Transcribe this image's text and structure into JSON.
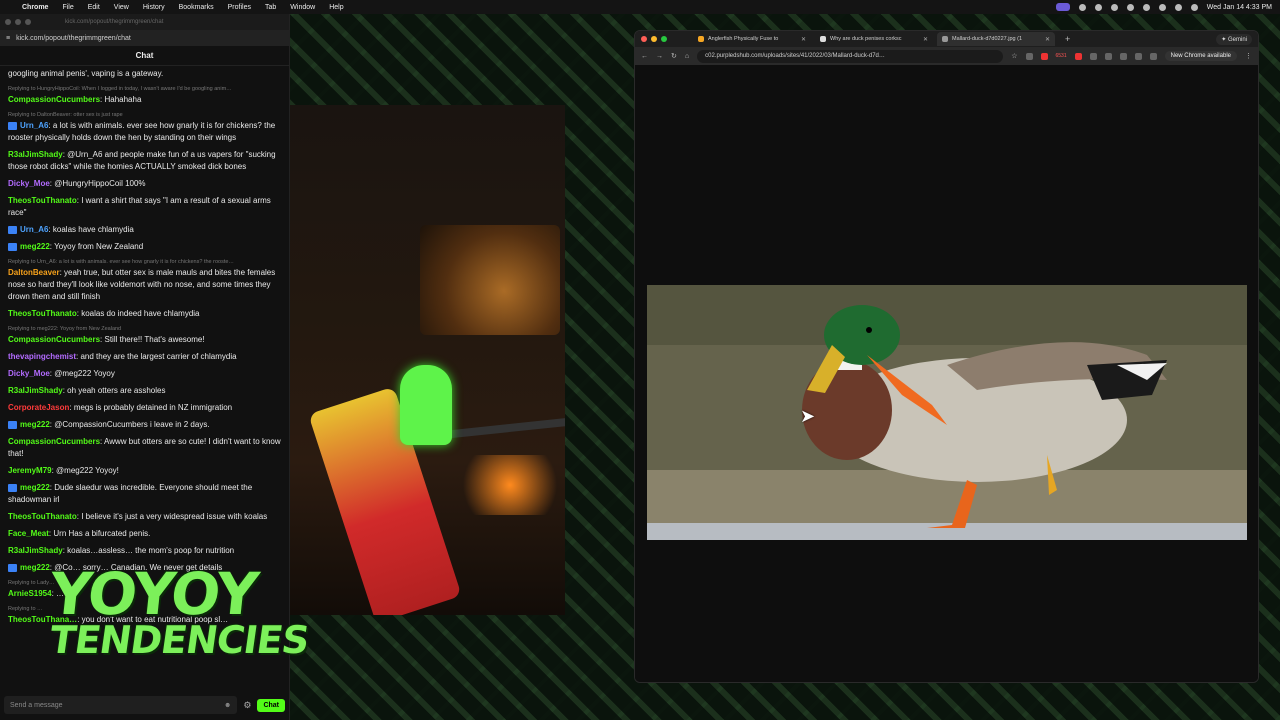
{
  "menubar": {
    "app": "Chrome",
    "items": [
      "File",
      "Edit",
      "View",
      "History",
      "Bookmarks",
      "Profiles",
      "Tab",
      "Window",
      "Help"
    ],
    "clock": "Wed Jan 14  4:33 PM"
  },
  "chat": {
    "top_faint": "kick.com/popout/thegrimmgreen/chat",
    "url": "kick.com/popout/thegrimmgreen/chat",
    "header": "Chat",
    "input_placeholder": "Send a message",
    "send_label": "Chat",
    "messages": [
      {
        "user": "",
        "color": "#eaeaea",
        "text": "googling animal penis', vaping is a gateway.",
        "reply": "",
        "badge": false
      },
      {
        "user": "CompassionCucumbers",
        "color": "#53fc18",
        "text": "Hahahaha",
        "reply": "Replying to HungryHippoCoil: When I logged in today, I wasn't aware I'd be googling anim…",
        "badge": false
      },
      {
        "user": "Urn_A6",
        "color": "#4ea3ff",
        "text": "a lot is with animals. ever see how gnarly it is for chickens? the rooster physically holds down the hen by standing on their wings",
        "reply": "Replying to DaltonBeaver: otter sex is just rape",
        "badge": true
      },
      {
        "user": "R3alJimShady",
        "color": "#53fc18",
        "text": "@Urn_A6 and people make fun of a us vapers for \"sucking those robot dicks\" while the homies ACTUALLY smoked dick bones",
        "reply": "",
        "badge": false
      },
      {
        "user": "Dicky_Moe",
        "color": "#b36bff",
        "text": "@HungryHippoCoil 100%",
        "reply": "",
        "badge": false
      },
      {
        "user": "TheosTouThanato",
        "color": "#53fc18",
        "text": "I want a shirt that says \"I am a result of a sexual arms race\"",
        "reply": "",
        "badge": false
      },
      {
        "user": "Urn_A6",
        "color": "#4ea3ff",
        "text": "koalas have chlamydia",
        "reply": "",
        "badge": true
      },
      {
        "user": "meg222",
        "color": "#53fc18",
        "text": "Yoyoy from New Zealand",
        "reply": "",
        "badge": true
      },
      {
        "user": "DaltonBeaver",
        "color": "#f7a21b",
        "text": "yeah true, but otter sex is male mauls and bites the females nose so hard they'll look like voldemort with no nose, and some times they drown them and still finish",
        "reply": "Replying to Urn_A6: a lot is with animals. ever see how gnarly it is for chickens? the rooste…",
        "badge": false
      },
      {
        "user": "TheosTouThanato",
        "color": "#53fc18",
        "text": "koalas do indeed have chlamydia",
        "reply": "",
        "badge": false
      },
      {
        "user": "CompassionCucumbers",
        "color": "#53fc18",
        "text": "Still there!! That's awesome!",
        "reply": "Replying to meg222: Yoyoy from New Zealand",
        "badge": false
      },
      {
        "user": "thevapingchemist",
        "color": "#b36bff",
        "text": "and they are the largest carrier of chlamydia",
        "reply": "",
        "badge": false
      },
      {
        "user": "Dicky_Moe",
        "color": "#b36bff",
        "text": "@meg222 Yoyoy",
        "reply": "",
        "badge": false
      },
      {
        "user": "R3alJimShady",
        "color": "#53fc18",
        "text": "oh yeah otters are assholes",
        "reply": "",
        "badge": false
      },
      {
        "user": "CorporateJason",
        "color": "#ff3b3b",
        "text": "megs is probably detained in NZ immigration",
        "reply": "",
        "badge": false
      },
      {
        "user": "meg222",
        "color": "#53fc18",
        "text": "@CompassionCucumbers i leave in 2 days.",
        "reply": "",
        "badge": true
      },
      {
        "user": "CompassionCucumbers",
        "color": "#53fc18",
        "text": "Awww but otters are so cute! I didn't want to know that!",
        "reply": "",
        "badge": false
      },
      {
        "user": "JeremyM79",
        "color": "#53fc18",
        "text": "@meg222 Yoyoy!",
        "reply": "",
        "badge": false
      },
      {
        "user": "meg222",
        "color": "#53fc18",
        "text": "Dude slaedur was incredible. Everyone should meet the shadowman irl",
        "reply": "",
        "badge": true
      },
      {
        "user": "TheosTouThanato",
        "color": "#53fc18",
        "text": "I believe it's just a very widespread issue with koalas",
        "reply": "",
        "badge": false
      },
      {
        "user": "Face_Meat",
        "color": "#53fc18",
        "text": "Urn Has a bifurcated penis.",
        "reply": "",
        "badge": false
      },
      {
        "user": "R3alJimShady",
        "color": "#53fc18",
        "text": "koalas…assless… the mom's poop for nutrition",
        "reply": "",
        "badge": false
      },
      {
        "user": "meg222",
        "color": "#53fc18",
        "text": "@Co… sorry… Canadian. We never get details",
        "reply": "",
        "badge": true
      },
      {
        "user": "ArnieS1954",
        "color": "#53fc18",
        "text": "…",
        "reply": "Replying to Lady…",
        "badge": false
      },
      {
        "user": "TheosTouThana…",
        "color": "#53fc18",
        "text": "you don't want to eat nutritional poop sl…",
        "reply": "Replying to …",
        "badge": false
      }
    ]
  },
  "logo": {
    "line1": "YOYOY",
    "line2": "TENDENCIES"
  },
  "browser": {
    "tabs": [
      {
        "title": "Anglerfish Physically Fuse to",
        "active": false
      },
      {
        "title": "Why are duck penises corksc",
        "active": false
      },
      {
        "title": "Mallard-duck-d7d0227.jpg (1",
        "active": true
      }
    ],
    "gemini": "Gemini",
    "url": "c02.purpledshub.com/uploads/sites/41/2022/03/Mallard-duck-d7d…",
    "ext_count": "6531",
    "update_label": "New Chrome available"
  },
  "colors": {
    "kick_green": "#53fc18",
    "tl_red": "#ff5f57",
    "tl_yellow": "#febc2e",
    "tl_green": "#28c840"
  }
}
